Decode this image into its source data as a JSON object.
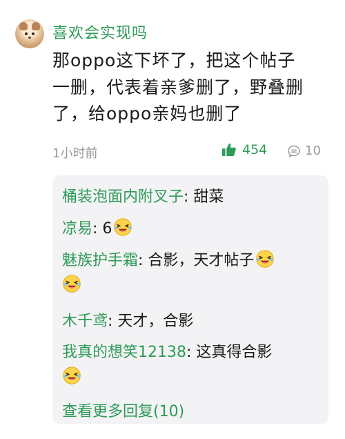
{
  "comment": {
    "username": "喜欢会实现吗",
    "content_lines": [
      "那oppo这下坏了，把这个帖子",
      "一删，代表着亲爹删了，野叠删",
      "了，给oppo亲妈也删了"
    ],
    "time": "1小时前",
    "likes": "454",
    "replies_count": "10"
  },
  "replies": [
    {
      "name": "桶装泡面内附叉子",
      "text": ": 甜菜"
    },
    {
      "name": "凉易",
      "text": ": 6"
    },
    {
      "name": "魅族护手霜",
      "text": ": 合影，天才帖子"
    },
    {
      "name": "木千鸢",
      "text": ": 天才，合影"
    },
    {
      "name": "我真的想笑12138",
      "text": ": 这真得合影"
    }
  ],
  "more_replies": "查看更多回复(10)",
  "colors": {
    "accent": "#2e9b57",
    "meta": "#9a9a9a",
    "panel": "#f3f3f5"
  },
  "icons": {
    "like": "thumbs-up-icon",
    "comment": "comment-bubble-icon",
    "emoji": "laughing-emoji-icon"
  }
}
